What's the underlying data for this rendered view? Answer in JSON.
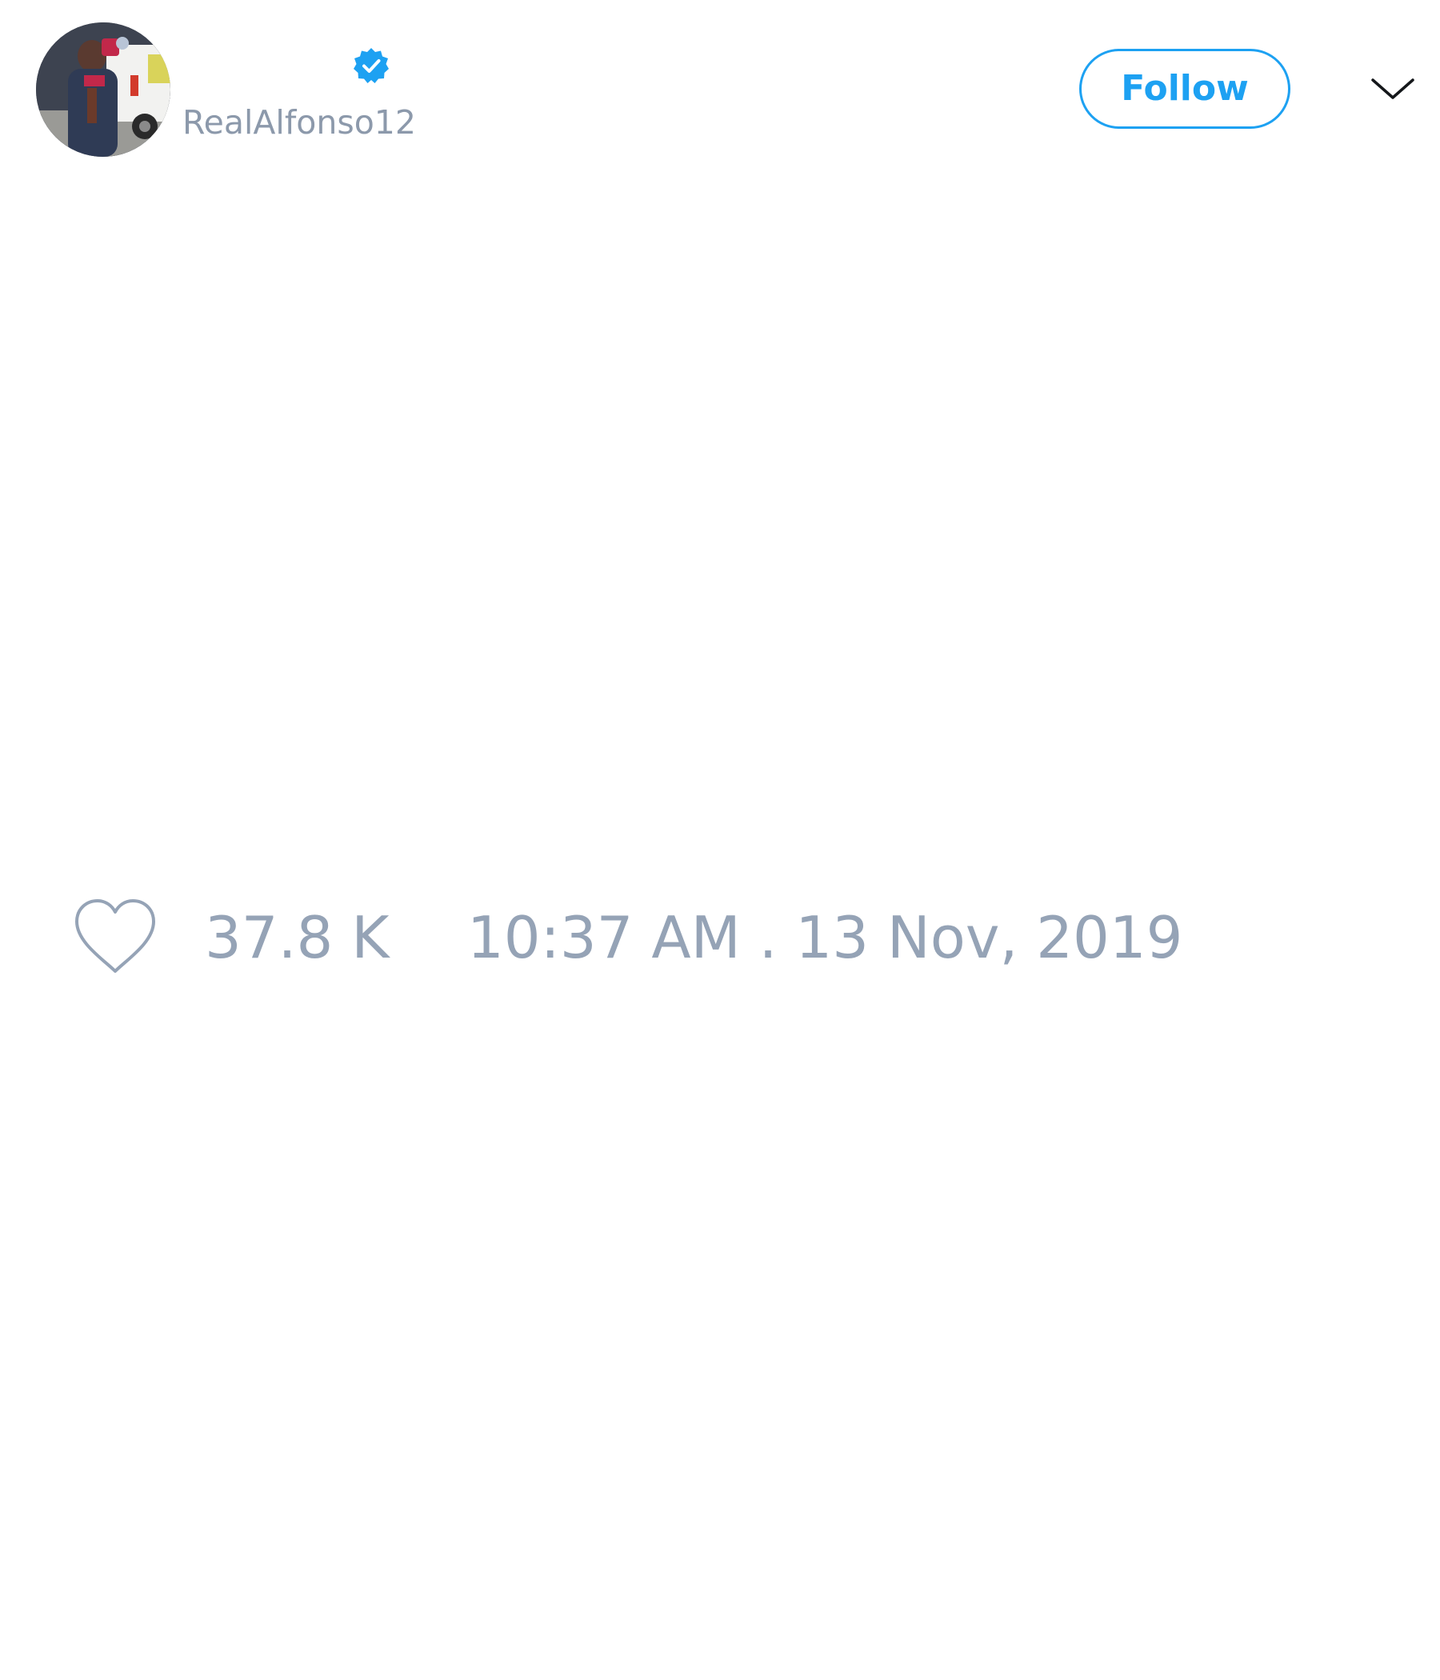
{
  "header": {
    "display_name": "",
    "handle": "RealAlfonso12",
    "verified": true,
    "follow_label": "Follow",
    "menu_icon": "chevron-down-icon"
  },
  "tweet": {
    "like_icon": "heart-icon",
    "like_count": "37.8 K",
    "timestamp": "10:37 AM . 13 Nov, 2019"
  },
  "colors": {
    "accent": "#1da1f2",
    "meta_text": "#95a3b6",
    "handle_text": "#8c99ab",
    "background": "#ffffff"
  }
}
